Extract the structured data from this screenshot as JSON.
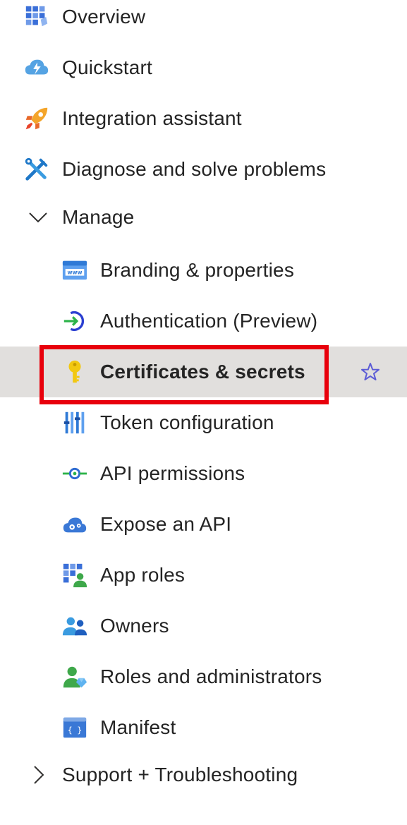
{
  "nav": {
    "overview": {
      "label": "Overview",
      "icon": "overview-grid-icon"
    },
    "quickstart": {
      "label": "Quickstart",
      "icon": "quickstart-cloud-icon"
    },
    "integration": {
      "label": "Integration assistant",
      "icon": "rocket-icon"
    },
    "diagnose": {
      "label": "Diagnose and solve problems",
      "icon": "wrench-screwdriver-icon"
    },
    "manage": {
      "label": "Manage",
      "expanded": true,
      "items": [
        {
          "label": "Branding & properties",
          "icon": "www-browser-icon"
        },
        {
          "label": "Authentication (Preview)",
          "icon": "authentication-icon"
        },
        {
          "label": "Certificates & secrets",
          "icon": "key-icon",
          "selected": true
        },
        {
          "label": "Token configuration",
          "icon": "token-bars-icon"
        },
        {
          "label": "API permissions",
          "icon": "api-permissions-icon"
        },
        {
          "label": "Expose an API",
          "icon": "cloud-gear-icon"
        },
        {
          "label": "App roles",
          "icon": "app-roles-icon"
        },
        {
          "label": "Owners",
          "icon": "owners-icon"
        },
        {
          "label": "Roles and administrators",
          "icon": "roles-admin-icon"
        },
        {
          "label": "Manifest",
          "icon": "manifest-icon"
        }
      ]
    },
    "support": {
      "label": "Support + Troubleshooting",
      "expanded": false
    }
  },
  "colors": {
    "selected_background": "#e1dfdd",
    "highlight_border": "#e8000b",
    "favorite_star": "#5c5cd6"
  }
}
